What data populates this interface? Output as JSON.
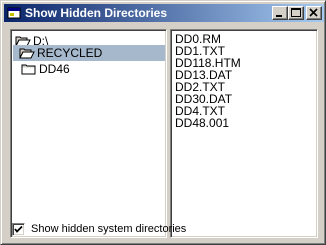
{
  "window": {
    "title": "Show Hidden Directories"
  },
  "titlebar_buttons": {
    "minimize_icon": "minimize-icon",
    "maximize_icon": "maximize-icon",
    "close_icon": "close-icon"
  },
  "directories": {
    "root": "D:\\",
    "items": [
      "RECYCLED",
      "DD46"
    ],
    "selected": "RECYCLED"
  },
  "files": [
    "DD0.RM",
    "DD1.TXT",
    "DD118.HTM",
    "DD13.DAT",
    "DD2.TXT",
    "DD30.DAT",
    "DD4.TXT",
    "DD48.001"
  ],
  "checkbox": {
    "label": "Show hidden system directories",
    "checked": true
  },
  "colors": {
    "title_gradient_start": "#0a246a",
    "title_gradient_end": "#a6caf0",
    "selection": "#a6b8cc",
    "face": "#d4d0c8"
  }
}
